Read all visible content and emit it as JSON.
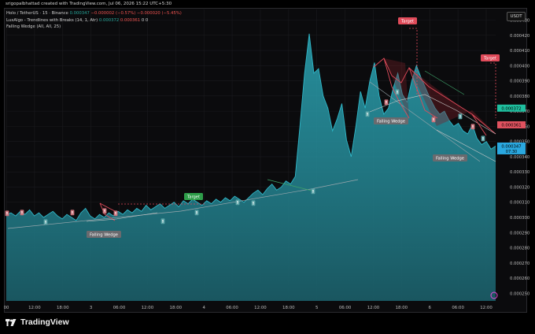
{
  "header": {
    "caption": "srigopalbhattad created with TradingView.com, Jul 06, 2026 15:22 UTC+5:30"
  },
  "legend": {
    "symbol": "Holo / TetherUS · 15 · Binance",
    "ohlc": [
      "0.000347",
      "−0.000002",
      "(−0.57%)",
      "−0.000020",
      "(−5.45%)"
    ],
    "indicator1_name": "LuxAlgo - Trendlines with Breaks (14, 1, Atr)",
    "indicator1_v1": "0.000372",
    "indicator1_v2": "0.000361",
    "indicator1_v3": "0",
    "indicator1_v4": "0",
    "indicator2_name": "Falling Wedge (All, All, 25)"
  },
  "toolbar": {
    "currency_label": "USDT"
  },
  "brand": {
    "name": "TradingView"
  },
  "colors": {
    "area_line": "#2fb7c8",
    "area_fill": "#1a5a64",
    "wedge": "#e04b5a",
    "up": "#26a69a",
    "down": "#ef5350",
    "grid": "#1b1b1f"
  },
  "chart_data": {
    "type": "area",
    "symbol": "HOT/USDT",
    "timeframe": "15",
    "ylim": [
      0.000245,
      0.000437
    ],
    "yticks": [
      "0.000430",
      "0.000420",
      "0.000410",
      "0.000400",
      "0.000390",
      "0.000380",
      "0.000370",
      "0.000360",
      "0.000350",
      "0.000340",
      "0.000330",
      "0.000320",
      "0.000310",
      "0.000300",
      "0.000290",
      "0.000280",
      "0.000270",
      "0.000260",
      "0.000250"
    ],
    "xticks": [
      "00",
      "12:00",
      "18:00",
      "3",
      "06:00",
      "12:00",
      "18:00",
      "4",
      "06:00",
      "12:00",
      "18:00",
      "5",
      "06:00",
      "12:00",
      "18:00",
      "6",
      "06:00",
      "12:00"
    ],
    "series": [
      {
        "values": [
          0.000302,
          0.000303,
          0.000301,
          0.000304,
          0.000302,
          0.000305,
          0.000301,
          0.000303,
          0.0003,
          0.000302,
          0.000304,
          0.000301,
          0.000299,
          0.000302,
          0.0003,
          0.000298,
          0.000303,
          0.000306,
          0.000301,
          0.000299,
          0.000302,
          0.0003,
          0.000303,
          0.000301,
          0.000304,
          0.000302,
          0.000305,
          0.000303,
          0.000306,
          0.000304,
          0.000308,
          0.000305,
          0.000307,
          0.000309,
          0.000306,
          0.000308,
          0.00031,
          0.000307,
          0.000311,
          0.000309,
          0.000312,
          0.00031,
          0.000308,
          0.000311,
          0.000309,
          0.000312,
          0.00031,
          0.000313,
          0.000311,
          0.000314,
          0.000312,
          0.00031,
          0.000313,
          0.000316,
          0.000318,
          0.000315,
          0.000319,
          0.000322,
          0.000318,
          0.00032,
          0.000324,
          0.000322,
          0.000327,
          0.00036,
          0.000395,
          0.000421,
          0.000395,
          0.000398,
          0.00038,
          0.000372,
          0.000357,
          0.000365,
          0.000375,
          0.000351,
          0.00034,
          0.00036,
          0.000383,
          0.000372,
          0.00039,
          0.000402,
          0.00038,
          0.000368,
          0.000372,
          0.000385,
          0.000395,
          0.000381,
          0.000376,
          0.00039,
          0.0004,
          0.000392,
          0.000385,
          0.000378,
          0.000372,
          0.000368,
          0.00037,
          0.000364,
          0.00036,
          0.000362,
          0.000357,
          0.000355,
          0.000361,
          0.000352,
          0.000348,
          0.00035,
          0.000345,
          0.000347
        ]
      }
    ],
    "last_price": "0.000347",
    "last_price_sub": "07:30",
    "line_value_1": "0.000372",
    "line_value_2": "0.000361",
    "annotations": [
      "Falling Wedge",
      "Falling Wedge",
      "Falling Wedge",
      "Target",
      "Target",
      "Target"
    ],
    "break_marker_labels": [
      "B",
      "R"
    ]
  }
}
